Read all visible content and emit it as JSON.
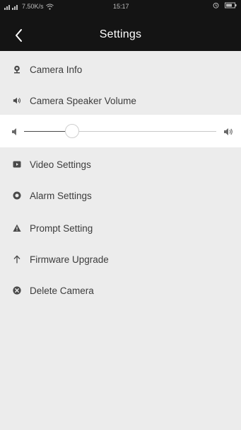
{
  "status_bar": {
    "network_speed": "7.50K/s",
    "time": "15:17"
  },
  "header": {
    "title": "Settings"
  },
  "menu": {
    "camera_info": "Camera Info",
    "speaker_volume": "Camera Speaker Volume",
    "video_settings": "Video Settings",
    "alarm_settings": "Alarm Settings",
    "prompt_setting": "Prompt Setting",
    "firmware_upgrade": "Firmware Upgrade",
    "delete_camera": "Delete Camera"
  },
  "volume_slider": {
    "level": 0.25
  },
  "icons": {
    "camera_info": "camera-icon",
    "speaker_volume": "speaker-icon",
    "video_settings": "video-icon",
    "alarm_settings": "alarm-icon",
    "prompt_setting": "warning-icon",
    "firmware_upgrade": "arrow-up-icon",
    "delete_camera": "delete-icon"
  },
  "colors": {
    "header_bg": "#141414",
    "page_bg": "#ececec",
    "icon": "#4a4a4a"
  }
}
